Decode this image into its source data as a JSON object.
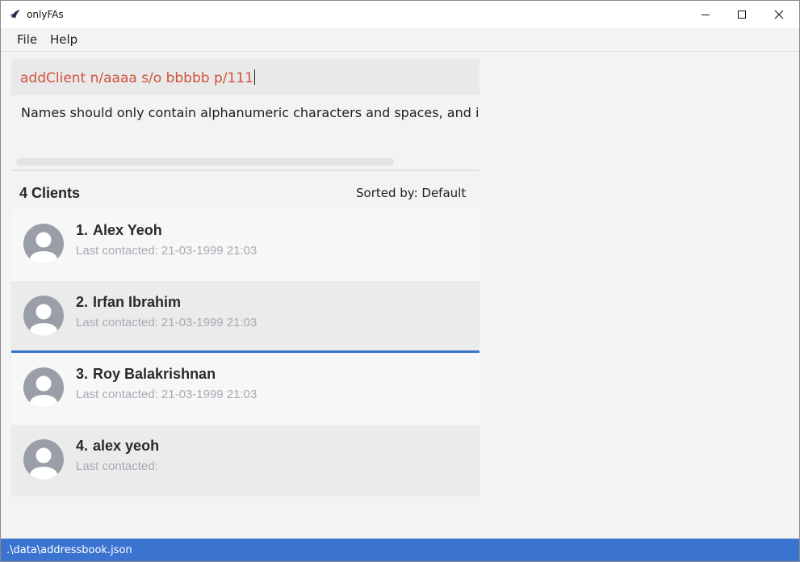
{
  "window": {
    "title": "onlyFAs",
    "controls": {
      "minimize": "minimize",
      "maximize": "maximize",
      "close": "close"
    }
  },
  "menu": {
    "file": "File",
    "help": "Help"
  },
  "command": {
    "value": "addClient n/aaaa s/o bbbbb p/111"
  },
  "result": {
    "message": "Names should only contain alphanumeric characters and spaces, and it should not be blank"
  },
  "list": {
    "count_label": "4 Clients",
    "sort_label": "Sorted by: Default",
    "clients": [
      {
        "index": "1.",
        "name": "Alex Yeoh",
        "contacted": "Last contacted: 21-03-1999 21:03"
      },
      {
        "index": "2.",
        "name": "Irfan Ibrahim",
        "contacted": "Last contacted: 21-03-1999 21:03"
      },
      {
        "index": "3.",
        "name": "Roy Balakrishnan",
        "contacted": "Last contacted: 21-03-1999 21:03"
      },
      {
        "index": "4.",
        "name": "alex yeoh",
        "contacted": "Last contacted:"
      }
    ]
  },
  "status": {
    "path": ".\\data\\addressbook.json"
  },
  "colors": {
    "accent": "#3b73d1",
    "command_text": "#d0533d",
    "muted_text": "#a9a9b4"
  },
  "icons": {
    "app": "app-logo-icon",
    "avatar": "user-avatar-icon"
  }
}
